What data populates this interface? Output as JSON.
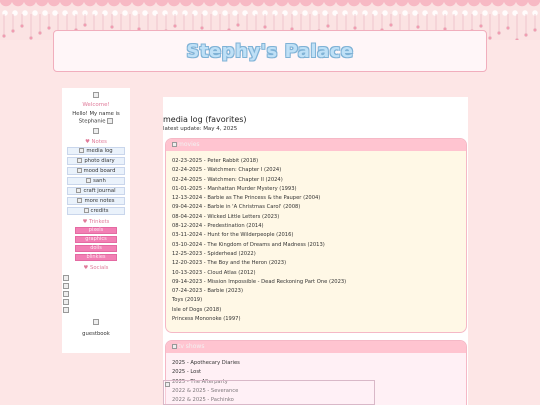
{
  "site": {
    "title": "Stephy's Palace"
  },
  "sidebar": {
    "welcome": "Welcome!",
    "hello": "Hello! My name is Stephanie",
    "notes_heading": "♥ Notes",
    "nav": [
      {
        "label": "media log"
      },
      {
        "label": "photo diary"
      },
      {
        "label": "mood board"
      },
      {
        "label": "sanh"
      },
      {
        "label": "craft journal"
      },
      {
        "label": "more notes"
      },
      {
        "label": "credits"
      }
    ],
    "trinkets_heading": "♥ Trinkets",
    "trinkets": [
      {
        "label": "pixels"
      },
      {
        "label": "graphics"
      },
      {
        "label": "dolls"
      },
      {
        "label": "blinkies"
      }
    ],
    "socials_heading": "♥ Socials",
    "guestbook": "guestbook"
  },
  "main": {
    "heading": "media log (favorites)",
    "updated": "latest update: May 4, 2025",
    "movies": {
      "title": "movies",
      "items": [
        "02-23-2025 - Peter Rabbit (2018)",
        "02-24-2025 - Watchmen: Chapter I (2024)",
        "02-24-2025 - Watchmen: Chapter II (2024)",
        "01-01-2025 - Manhattan Murder Mystery (1993)",
        "12-13-2024 - Barbie as The Princess & the Pauper (2004)",
        "09-04-2024 - Barbie in 'A Christmas Carol' (2008)",
        "08-04-2024 - Wicked Little Letters (2023)",
        "08-12-2024 - Predestination (2014)",
        "03-11-2024 - Hunt for the Wilderpeople (2016)",
        "03-10-2024 - The Kingdom of Dreams and Madness (2013)",
        "12-25-2023 - Spiderhead (2022)",
        "12-20-2023 - The Boy and the Heron (2023)",
        "10-13-2023 - Cloud Atlas (2012)",
        "09-14-2023 - Mission Impossible - Dead Reckoning Part One (2023)",
        "07-24-2023 - Barbie (2023)",
        "Toys (2019)",
        "Isle of Dogs (2018)",
        "Princess Mononoke (1997)"
      ]
    },
    "tv": {
      "title": "tv shows",
      "items": [
        "2025 - Apothecary Diaries",
        "2025 - Lost",
        "2025 - The Afterparty",
        "2022 & 2025 - Severance",
        "2022 & 2025 - Pachinko"
      ]
    }
  }
}
